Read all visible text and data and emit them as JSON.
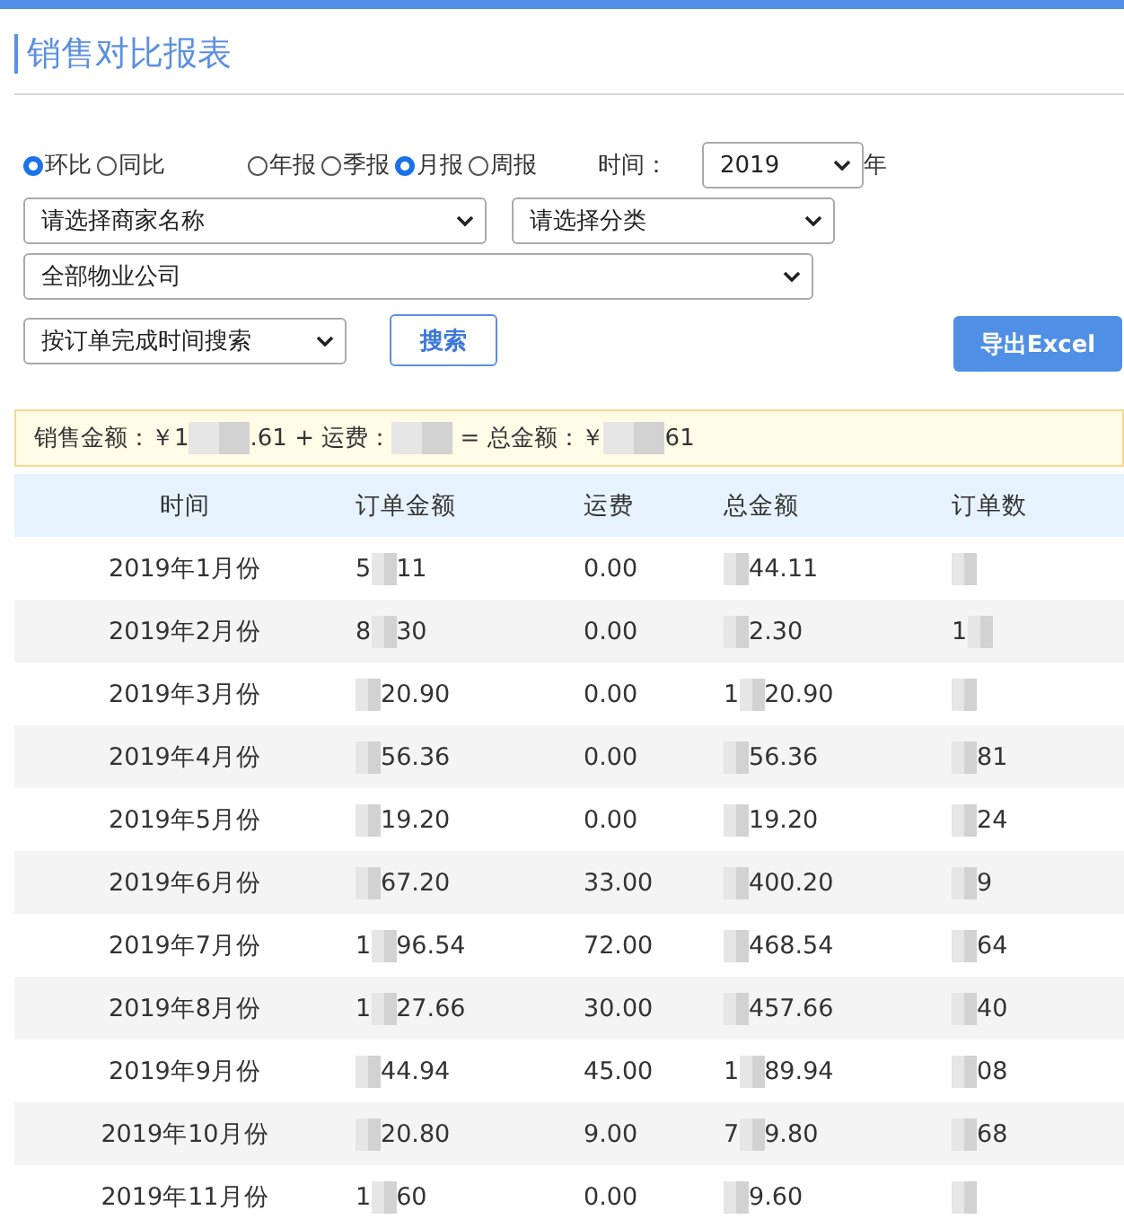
{
  "title": "销售对比报表",
  "compare_modes": [
    {
      "label": "环比",
      "selected": true
    },
    {
      "label": "同比",
      "selected": false
    }
  ],
  "periods": [
    {
      "label": "年报",
      "selected": false
    },
    {
      "label": "季报",
      "selected": false
    },
    {
      "label": "月报",
      "selected": true
    },
    {
      "label": "周报",
      "selected": false
    }
  ],
  "time_label": "时间：",
  "year_select": "2019",
  "year_unit": "年",
  "merchant_select": "请选择商家名称",
  "category_select": "请选择分类",
  "company_select": "全部物业公司",
  "search_mode_select": "按订单完成时间搜索",
  "search_button": "搜索",
  "export_button": "导出Excel",
  "summary": [
    {
      "kind": "text",
      "text": "销售金额：￥1"
    },
    {
      "kind": "redaction"
    },
    {
      "kind": "text",
      "text": ".61 + 运费："
    },
    {
      "kind": "redaction"
    },
    {
      "kind": "text",
      "text": " = 总金额：￥"
    },
    {
      "kind": "redaction"
    },
    {
      "kind": "text",
      "text": "61"
    }
  ],
  "table": {
    "columns": [
      "时间",
      "订单金额",
      "运费",
      "总金额",
      "订单数"
    ],
    "rows": [
      [
        [
          {
            "kind": "text",
            "text": "2019年1月份"
          }
        ],
        [
          {
            "kind": "text",
            "text": "5"
          },
          {
            "kind": "redaction"
          },
          {
            "kind": "text",
            "text": "11"
          }
        ],
        [
          {
            "kind": "text",
            "text": "0.00"
          }
        ],
        [
          {
            "kind": "redaction"
          },
          {
            "kind": "text",
            "text": "44.11"
          }
        ],
        [
          {
            "kind": "redaction"
          }
        ]
      ],
      [
        [
          {
            "kind": "text",
            "text": "2019年2月份"
          }
        ],
        [
          {
            "kind": "text",
            "text": "8"
          },
          {
            "kind": "redaction"
          },
          {
            "kind": "text",
            "text": "30"
          }
        ],
        [
          {
            "kind": "text",
            "text": "0.00"
          }
        ],
        [
          {
            "kind": "redaction"
          },
          {
            "kind": "text",
            "text": "2.30"
          }
        ],
        [
          {
            "kind": "text",
            "text": "1"
          },
          {
            "kind": "redaction"
          }
        ]
      ],
      [
        [
          {
            "kind": "text",
            "text": "2019年3月份"
          }
        ],
        [
          {
            "kind": "redaction"
          },
          {
            "kind": "text",
            "text": "20.90"
          }
        ],
        [
          {
            "kind": "text",
            "text": "0.00"
          }
        ],
        [
          {
            "kind": "text",
            "text": "1"
          },
          {
            "kind": "redaction"
          },
          {
            "kind": "text",
            "text": "20.90"
          }
        ],
        [
          {
            "kind": "redaction"
          }
        ]
      ],
      [
        [
          {
            "kind": "text",
            "text": "2019年4月份"
          }
        ],
        [
          {
            "kind": "redaction"
          },
          {
            "kind": "text",
            "text": "56.36"
          }
        ],
        [
          {
            "kind": "text",
            "text": "0.00"
          }
        ],
        [
          {
            "kind": "redaction"
          },
          {
            "kind": "text",
            "text": "56.36"
          }
        ],
        [
          {
            "kind": "redaction"
          },
          {
            "kind": "text",
            "text": "81"
          }
        ]
      ],
      [
        [
          {
            "kind": "text",
            "text": "2019年5月份"
          }
        ],
        [
          {
            "kind": "redaction"
          },
          {
            "kind": "text",
            "text": "19.20"
          }
        ],
        [
          {
            "kind": "text",
            "text": "0.00"
          }
        ],
        [
          {
            "kind": "redaction"
          },
          {
            "kind": "text",
            "text": "19.20"
          }
        ],
        [
          {
            "kind": "redaction"
          },
          {
            "kind": "text",
            "text": "24"
          }
        ]
      ],
      [
        [
          {
            "kind": "text",
            "text": "2019年6月份"
          }
        ],
        [
          {
            "kind": "redaction"
          },
          {
            "kind": "text",
            "text": "67.20"
          }
        ],
        [
          {
            "kind": "text",
            "text": "33.00"
          }
        ],
        [
          {
            "kind": "redaction"
          },
          {
            "kind": "text",
            "text": "400.20"
          }
        ],
        [
          {
            "kind": "redaction"
          },
          {
            "kind": "text",
            "text": "9"
          }
        ]
      ],
      [
        [
          {
            "kind": "text",
            "text": "2019年7月份"
          }
        ],
        [
          {
            "kind": "text",
            "text": "1"
          },
          {
            "kind": "redaction"
          },
          {
            "kind": "text",
            "text": "96.54"
          }
        ],
        [
          {
            "kind": "text",
            "text": "72.00"
          }
        ],
        [
          {
            "kind": "redaction"
          },
          {
            "kind": "text",
            "text": "468.54"
          }
        ],
        [
          {
            "kind": "redaction"
          },
          {
            "kind": "text",
            "text": "64"
          }
        ]
      ],
      [
        [
          {
            "kind": "text",
            "text": "2019年8月份"
          }
        ],
        [
          {
            "kind": "text",
            "text": "1"
          },
          {
            "kind": "redaction"
          },
          {
            "kind": "text",
            "text": "27.66"
          }
        ],
        [
          {
            "kind": "text",
            "text": "30.00"
          }
        ],
        [
          {
            "kind": "redaction"
          },
          {
            "kind": "text",
            "text": "457.66"
          }
        ],
        [
          {
            "kind": "redaction"
          },
          {
            "kind": "text",
            "text": "40"
          }
        ]
      ],
      [
        [
          {
            "kind": "text",
            "text": "2019年9月份"
          }
        ],
        [
          {
            "kind": "redaction"
          },
          {
            "kind": "text",
            "text": "44.94"
          }
        ],
        [
          {
            "kind": "text",
            "text": "45.00"
          }
        ],
        [
          {
            "kind": "text",
            "text": "1"
          },
          {
            "kind": "redaction"
          },
          {
            "kind": "text",
            "text": "89.94"
          }
        ],
        [
          {
            "kind": "redaction"
          },
          {
            "kind": "text",
            "text": "08"
          }
        ]
      ],
      [
        [
          {
            "kind": "text",
            "text": "2019年10月份"
          }
        ],
        [
          {
            "kind": "redaction"
          },
          {
            "kind": "text",
            "text": "20.80"
          }
        ],
        [
          {
            "kind": "text",
            "text": "9.00"
          }
        ],
        [
          {
            "kind": "text",
            "text": "7"
          },
          {
            "kind": "redaction"
          },
          {
            "kind": "text",
            "text": "9.80"
          }
        ],
        [
          {
            "kind": "redaction"
          },
          {
            "kind": "text",
            "text": "68"
          }
        ]
      ],
      [
        [
          {
            "kind": "text",
            "text": "2019年11月份"
          }
        ],
        [
          {
            "kind": "text",
            "text": "1"
          },
          {
            "kind": "redaction"
          },
          {
            "kind": "text",
            "text": "60"
          }
        ],
        [
          {
            "kind": "text",
            "text": "0.00"
          }
        ],
        [
          {
            "kind": "redaction"
          },
          {
            "kind": "text",
            "text": "9.60"
          }
        ],
        [
          {
            "kind": "redaction"
          }
        ]
      ]
    ]
  }
}
